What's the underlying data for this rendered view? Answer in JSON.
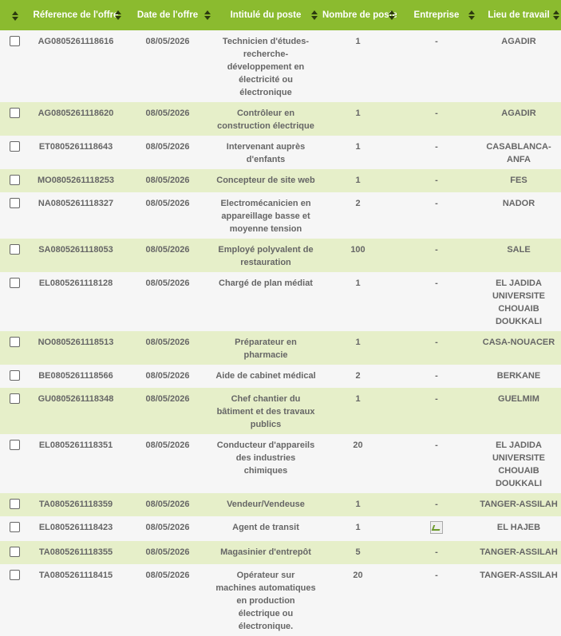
{
  "headers": {
    "select": "",
    "reference": "Réference de l'offre",
    "date": "Date de l'offre",
    "title": "Intitulé du poste",
    "count": "Nombre de postes",
    "company": "Entreprise",
    "location": "Lieu de travail"
  },
  "rows": [
    {
      "ref": "AG0805261118616",
      "date": "08/05/2026",
      "title": "Technicien d'études-recherche-développement en électricité ou électronique",
      "count": "1",
      "company": "-",
      "location": "AGADIR"
    },
    {
      "ref": "AG0805261118620",
      "date": "08/05/2026",
      "title": "Contrôleur en construction électrique",
      "count": "1",
      "company": "-",
      "location": "AGADIR"
    },
    {
      "ref": "ET0805261118643",
      "date": "08/05/2026",
      "title": "Intervenant auprès d'enfants",
      "count": "1",
      "company": "-",
      "location": "CASABLANCA-ANFA"
    },
    {
      "ref": "MO0805261118253",
      "date": "08/05/2026",
      "title": "Concepteur de site web",
      "count": "1",
      "company": "-",
      "location": "FES"
    },
    {
      "ref": "NA0805261118327",
      "date": "08/05/2026",
      "title": "Electromécanicien en appareillage basse et moyenne tension",
      "count": "2",
      "company": "-",
      "location": "NADOR"
    },
    {
      "ref": "SA0805261118053",
      "date": "08/05/2026",
      "title": "Employé polyvalent de restauration",
      "count": "100",
      "company": "-",
      "location": "SALE"
    },
    {
      "ref": "EL0805261118128",
      "date": "08/05/2026",
      "title": "Chargé de plan médiat",
      "count": "1",
      "company": "-",
      "location": "EL JADIDA UNIVERSITE CHOUAIB DOUKKALI"
    },
    {
      "ref": "NO0805261118513",
      "date": "08/05/2026",
      "title": "Préparateur en pharmacie",
      "count": "1",
      "company": "-",
      "location": "CASA-NOUACER"
    },
    {
      "ref": "BE0805261118566",
      "date": "08/05/2026",
      "title": "Aide de cabinet médical",
      "count": "2",
      "company": "-",
      "location": "BERKANE"
    },
    {
      "ref": "GU0805261118348",
      "date": "08/05/2026",
      "title": "Chef chantier du bâtiment et des travaux publics",
      "count": "1",
      "company": "-",
      "location": "GUELMIM"
    },
    {
      "ref": "EL0805261118351",
      "date": "08/05/2026",
      "title": "Conducteur d'appareils des industries chimiques",
      "count": "20",
      "company": "-",
      "location": "EL JADIDA UNIVERSITE CHOUAIB DOUKKALI"
    },
    {
      "ref": "TA0805261118359",
      "date": "08/05/2026",
      "title": "Vendeur/Vendeuse",
      "count": "1",
      "company": "-",
      "location": "TANGER-ASSILAH"
    },
    {
      "ref": "EL0805261118423",
      "date": "08/05/2026",
      "title": "Agent de transit",
      "count": "1",
      "company": "",
      "company_icon": "broken-image-icon",
      "location": "EL HAJEB"
    },
    {
      "ref": "TA0805261118355",
      "date": "08/05/2026",
      "title": "Magasinier d'entrepôt",
      "count": "5",
      "company": "-",
      "location": "TANGER-ASSILAH"
    },
    {
      "ref": "TA0805261118415",
      "date": "08/05/2026",
      "title": "Opérateur sur machines automatiques en production électrique ou électronique.",
      "count": "20",
      "company": "-",
      "location": "TANGER-ASSILAH"
    }
  ],
  "colors": {
    "header_bg": "#8bbb2f",
    "row_even": "#e6efc9",
    "row_odd": "#f6f6f6",
    "sort_icon": "#2c3a0f"
  }
}
